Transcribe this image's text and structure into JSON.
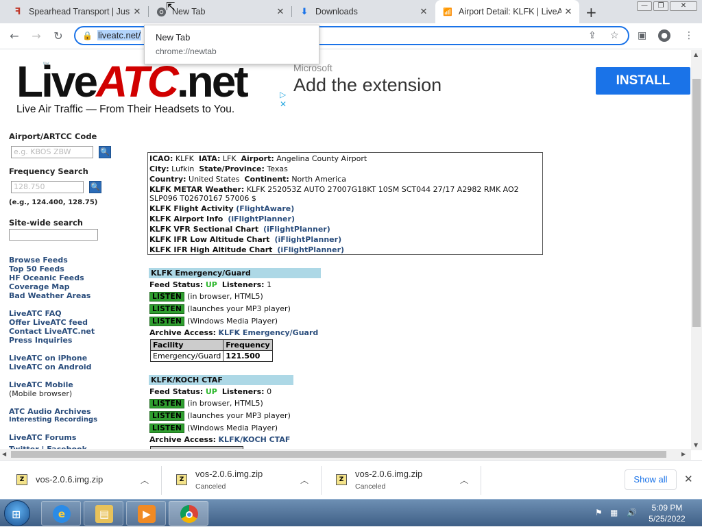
{
  "browser": {
    "tabs": [
      {
        "title": "Spearhead Transport | Just",
        "icon": "spearhead-icon"
      },
      {
        "title": "New Tab",
        "icon": "chrome-icon"
      },
      {
        "title": "Downloads",
        "icon": "download-icon"
      },
      {
        "title": "Airport Detail: KLFK | LiveA",
        "icon": "liveatc-icon"
      }
    ],
    "url": "liveatc.net/",
    "tooltip": {
      "title": "New Tab",
      "url": "chrome://newtab"
    }
  },
  "site": {
    "logo": {
      "part1": "Live",
      "part2": "ATC",
      "part3": ".net",
      "tagline": "Live Air Traffic — From Their Headsets to You."
    },
    "ad": {
      "source": "Microsoft",
      "headline": "Add the extension",
      "button": "INSTALL"
    },
    "sidebar": {
      "airport_label": "Airport/ARTCC Code",
      "airport_placeholder": "e.g. KBOS ZBW",
      "freq_label": "Frequency Search",
      "freq_placeholder": "128.750",
      "freq_example": "(e.g., 124.400, 128.75)",
      "site_search_label": "Site-wide search",
      "links1": [
        "Browse Feeds",
        "Top 50 Feeds",
        "HF Oceanic Feeds",
        "Coverage Map",
        "Bad Weather Areas"
      ],
      "links2": [
        "LiveATC FAQ",
        "Offer LiveATC feed",
        "Contact LiveATC.net",
        "Press Inquiries"
      ],
      "links3": [
        "LiveATC on iPhone",
        "LiveATC on Android"
      ],
      "mobile": {
        "link": "LiveATC Mobile",
        "note": "(Mobile browser)"
      },
      "archives": {
        "link": "ATC Audio Archives",
        "sub": "Interesting Recordings"
      },
      "forums": "LiveATC Forums",
      "social": "Twitter | Facebook"
    },
    "info": {
      "icao_label": "ICAO:",
      "icao": "KLFK",
      "iata_label": "IATA:",
      "iata": "LFK",
      "airport_label": "Airport:",
      "airport": "Angelina County Airport",
      "city_label": "City:",
      "city": "Lufkin",
      "state_label": "State/Province:",
      "state": "Texas",
      "country_label": "Country:",
      "country": "United States",
      "continent_label": "Continent:",
      "continent": "North America",
      "metar_label": "KLFK METAR Weather:",
      "metar1": "KLFK 252053Z AUTO 27007G18KT 10SM SCT044 27/17 A2982 RMK AO2",
      "metar2": "SLP096 T02670167 57006 $",
      "rows": [
        {
          "label": "KLFK Flight Activity",
          "link": "(FlightAware)"
        },
        {
          "label": "KLFK Airport Info",
          "link": "(iFlightPlanner)"
        },
        {
          "label": "KLFK VFR Sectional Chart",
          "link": "(iFlightPlanner)"
        },
        {
          "label": "KLFK IFR Low Altitude Chart",
          "link": "(iFlightPlanner)"
        },
        {
          "label": "KLFK IFR High Altitude Chart",
          "link": "(iFlightPlanner)"
        }
      ]
    },
    "feeds": [
      {
        "name": "KLFK Emergency/Guard",
        "status_label": "Feed Status:",
        "status": "UP",
        "listeners_label": "Listeners:",
        "listeners": "1",
        "listen": "LISTEN",
        "players": [
          "(in browser, HTML5)",
          "(launches your MP3 player)",
          "(Windows Media Player)"
        ],
        "archive_label": "Archive Access:",
        "archive_link": "KLFK Emergency/Guard",
        "table_headers": [
          "Facility",
          "Frequency"
        ],
        "table_rows": [
          [
            "Emergency/Guard",
            "121.500"
          ]
        ]
      },
      {
        "name": "KLFK/KOCH CTAF",
        "status_label": "Feed Status:",
        "status": "UP",
        "listeners_label": "Listeners:",
        "listeners": "0",
        "listen": "LISTEN",
        "players": [
          "(in browser, HTML5)",
          "(launches your MP3 player)",
          "(Windows Media Player)"
        ],
        "archive_label": "Archive Access:",
        "archive_link": "KLFK/KOCH CTAF"
      }
    ]
  },
  "downloads": {
    "items": [
      {
        "name": "vos-2.0.6.img.zip",
        "status": ""
      },
      {
        "name": "vos-2.0.6.img.zip",
        "status": "Canceled"
      },
      {
        "name": "vos-2.0.6.img.zip",
        "status": "Canceled"
      }
    ],
    "show_all": "Show all"
  },
  "taskbar": {
    "time": "5:09 PM",
    "date": "5/25/2022"
  },
  "colors": {
    "accent": "#1a73e8",
    "link": "#2a4d7c",
    "feed_header": "#add8e6",
    "listen_green": "#2f9e2f",
    "status_up": "#2fb82f",
    "logo_red": "#d10000"
  }
}
